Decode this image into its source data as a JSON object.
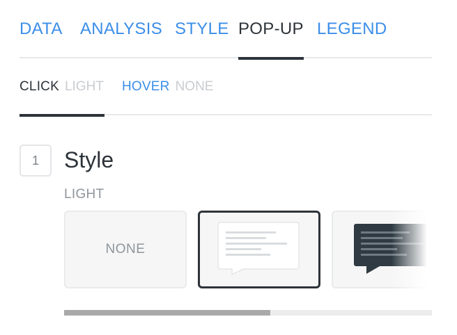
{
  "tabs": [
    {
      "label": "DATA",
      "active": false
    },
    {
      "label": "ANALYSIS",
      "active": false
    },
    {
      "label": "STYLE",
      "active": false
    },
    {
      "label": "POP-UP",
      "active": true
    },
    {
      "label": "LEGEND",
      "active": false
    }
  ],
  "subtabs": {
    "click": {
      "label": "CLICK",
      "value": "LIGHT"
    },
    "hover": {
      "label": "HOVER",
      "value": "NONE"
    }
  },
  "step": {
    "number": "1",
    "title": "Style"
  },
  "section_label": "LIGHT",
  "options": [
    {
      "label": "NONE",
      "selected": false
    },
    {
      "icon": "light-popup-preview-icon",
      "selected": true
    },
    {
      "icon": "dark-popup-preview-icon",
      "selected": false
    }
  ],
  "scroll": {
    "position_fraction": 0.56
  },
  "colors": {
    "accent": "#3b8ee8",
    "text_dark": "#2d3339",
    "muted": "#c9ccd0",
    "dark_popup": "#2f3a42"
  }
}
